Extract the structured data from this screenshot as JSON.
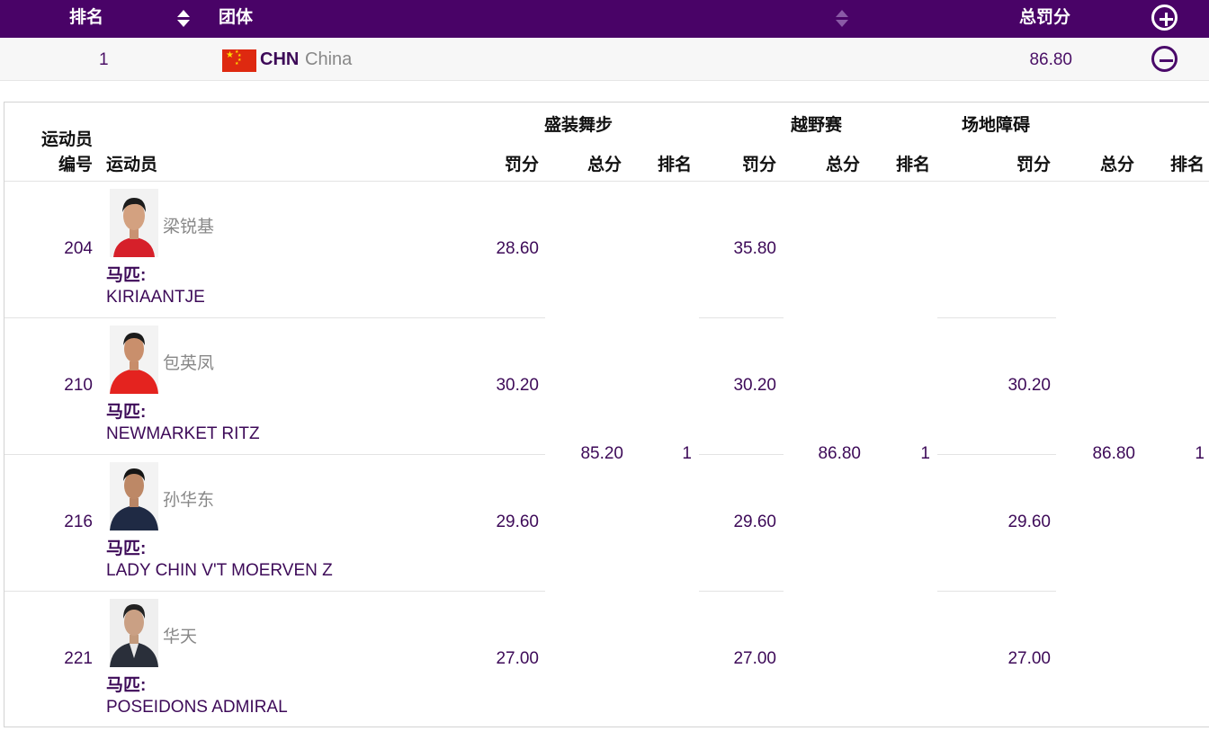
{
  "header": {
    "rank_label": "排名",
    "team_label": "团体",
    "total_penalty_label": "总罚分"
  },
  "team": {
    "rank": "1",
    "code": "CHN",
    "name": "China",
    "total": "86.80"
  },
  "detail": {
    "col_athlete_no_line1": "运动员",
    "col_athlete_no_line2": "编号",
    "col_athlete": "运动员",
    "phases": [
      {
        "name": "盛装舞步",
        "penalty_label": "罚分",
        "total_label": "总分",
        "rank_label": "排名",
        "phase_total": "85.20",
        "phase_rank": "1"
      },
      {
        "name": "越野赛",
        "penalty_label": "罚分",
        "total_label": "总分",
        "rank_label": "排名",
        "phase_total": "86.80",
        "phase_rank": "1"
      },
      {
        "name": "场地障碍",
        "penalty_label": "罚分",
        "total_label": "总分",
        "rank_label": "排名",
        "phase_total": "86.80",
        "phase_rank": "1"
      }
    ],
    "horse_label": "马匹:",
    "athletes": [
      {
        "no": "204",
        "name": "梁锐基",
        "horse": "KIRIAANTJE",
        "dressage": "28.60",
        "cross_country": "35.80",
        "jumping": ""
      },
      {
        "no": "210",
        "name": "包英凤",
        "horse": "NEWMARKET RITZ",
        "dressage": "30.20",
        "cross_country": "30.20",
        "jumping": "30.20"
      },
      {
        "no": "216",
        "name": "孙华东",
        "horse": "LADY CHIN V'T MOERVEN Z",
        "dressage": "29.60",
        "cross_country": "29.60",
        "jumping": "29.60"
      },
      {
        "no": "221",
        "name": "华天",
        "horse": "POSEIDONS ADMIRAL",
        "dressage": "27.00",
        "cross_country": "27.00",
        "jumping": "27.00"
      }
    ]
  },
  "colors": {
    "header_bg": "#490367",
    "value_text": "#3d0a58",
    "flag_red": "#de2910"
  },
  "icons": [
    "sort-icon",
    "expand-icon",
    "collapse-icon",
    "china-flag-icon"
  ]
}
